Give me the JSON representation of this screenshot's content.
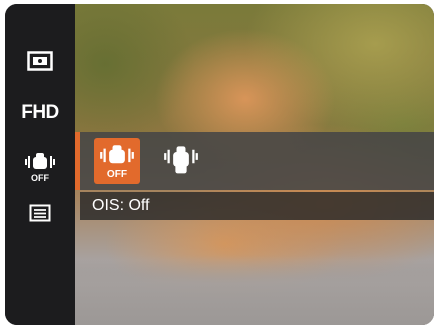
{
  "sidebar": {
    "items": [
      {
        "icon": "metering-icon",
        "label": ""
      },
      {
        "icon": "resolution-icon",
        "label": "FHD"
      },
      {
        "icon": "ois-off-icon",
        "label": "OFF"
      },
      {
        "icon": "menu-list-icon",
        "label": ""
      }
    ]
  },
  "submenu": {
    "options": [
      {
        "icon": "ois-off-icon",
        "label": "OFF",
        "selected": true
      },
      {
        "icon": "ois-on-icon",
        "label": "",
        "selected": false
      }
    ],
    "info_text": "OIS: Off"
  },
  "colors": {
    "accent": "#e26a2c",
    "sidebar_bg": "#1c1c1e",
    "submenu_bg": "#464646"
  }
}
